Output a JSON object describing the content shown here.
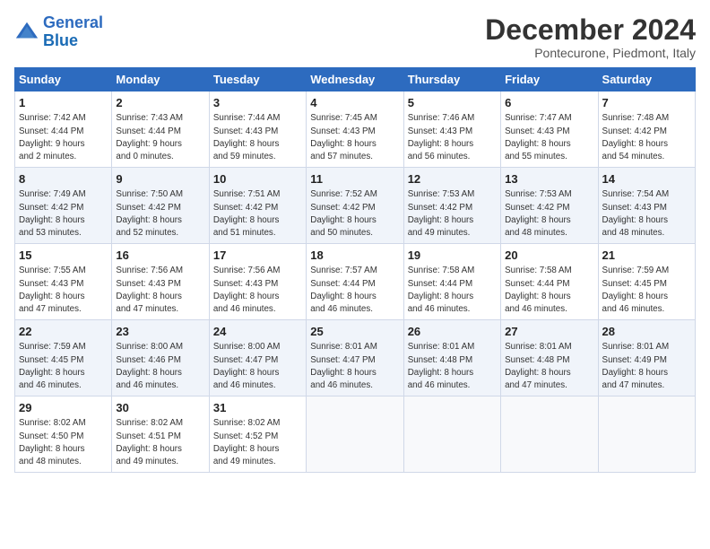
{
  "logo": {
    "line1": "General",
    "line2": "Blue"
  },
  "title": "December 2024",
  "subtitle": "Pontecurone, Piedmont, Italy",
  "days_header": [
    "Sunday",
    "Monday",
    "Tuesday",
    "Wednesday",
    "Thursday",
    "Friday",
    "Saturday"
  ],
  "weeks": [
    [
      {
        "num": "1",
        "info": "Sunrise: 7:42 AM\nSunset: 4:44 PM\nDaylight: 9 hours\nand 2 minutes."
      },
      {
        "num": "2",
        "info": "Sunrise: 7:43 AM\nSunset: 4:44 PM\nDaylight: 9 hours\nand 0 minutes."
      },
      {
        "num": "3",
        "info": "Sunrise: 7:44 AM\nSunset: 4:43 PM\nDaylight: 8 hours\nand 59 minutes."
      },
      {
        "num": "4",
        "info": "Sunrise: 7:45 AM\nSunset: 4:43 PM\nDaylight: 8 hours\nand 57 minutes."
      },
      {
        "num": "5",
        "info": "Sunrise: 7:46 AM\nSunset: 4:43 PM\nDaylight: 8 hours\nand 56 minutes."
      },
      {
        "num": "6",
        "info": "Sunrise: 7:47 AM\nSunset: 4:43 PM\nDaylight: 8 hours\nand 55 minutes."
      },
      {
        "num": "7",
        "info": "Sunrise: 7:48 AM\nSunset: 4:42 PM\nDaylight: 8 hours\nand 54 minutes."
      }
    ],
    [
      {
        "num": "8",
        "info": "Sunrise: 7:49 AM\nSunset: 4:42 PM\nDaylight: 8 hours\nand 53 minutes."
      },
      {
        "num": "9",
        "info": "Sunrise: 7:50 AM\nSunset: 4:42 PM\nDaylight: 8 hours\nand 52 minutes."
      },
      {
        "num": "10",
        "info": "Sunrise: 7:51 AM\nSunset: 4:42 PM\nDaylight: 8 hours\nand 51 minutes."
      },
      {
        "num": "11",
        "info": "Sunrise: 7:52 AM\nSunset: 4:42 PM\nDaylight: 8 hours\nand 50 minutes."
      },
      {
        "num": "12",
        "info": "Sunrise: 7:53 AM\nSunset: 4:42 PM\nDaylight: 8 hours\nand 49 minutes."
      },
      {
        "num": "13",
        "info": "Sunrise: 7:53 AM\nSunset: 4:42 PM\nDaylight: 8 hours\nand 48 minutes."
      },
      {
        "num": "14",
        "info": "Sunrise: 7:54 AM\nSunset: 4:43 PM\nDaylight: 8 hours\nand 48 minutes."
      }
    ],
    [
      {
        "num": "15",
        "info": "Sunrise: 7:55 AM\nSunset: 4:43 PM\nDaylight: 8 hours\nand 47 minutes."
      },
      {
        "num": "16",
        "info": "Sunrise: 7:56 AM\nSunset: 4:43 PM\nDaylight: 8 hours\nand 47 minutes."
      },
      {
        "num": "17",
        "info": "Sunrise: 7:56 AM\nSunset: 4:43 PM\nDaylight: 8 hours\nand 46 minutes."
      },
      {
        "num": "18",
        "info": "Sunrise: 7:57 AM\nSunset: 4:44 PM\nDaylight: 8 hours\nand 46 minutes."
      },
      {
        "num": "19",
        "info": "Sunrise: 7:58 AM\nSunset: 4:44 PM\nDaylight: 8 hours\nand 46 minutes."
      },
      {
        "num": "20",
        "info": "Sunrise: 7:58 AM\nSunset: 4:44 PM\nDaylight: 8 hours\nand 46 minutes."
      },
      {
        "num": "21",
        "info": "Sunrise: 7:59 AM\nSunset: 4:45 PM\nDaylight: 8 hours\nand 46 minutes."
      }
    ],
    [
      {
        "num": "22",
        "info": "Sunrise: 7:59 AM\nSunset: 4:45 PM\nDaylight: 8 hours\nand 46 minutes."
      },
      {
        "num": "23",
        "info": "Sunrise: 8:00 AM\nSunset: 4:46 PM\nDaylight: 8 hours\nand 46 minutes."
      },
      {
        "num": "24",
        "info": "Sunrise: 8:00 AM\nSunset: 4:47 PM\nDaylight: 8 hours\nand 46 minutes."
      },
      {
        "num": "25",
        "info": "Sunrise: 8:01 AM\nSunset: 4:47 PM\nDaylight: 8 hours\nand 46 minutes."
      },
      {
        "num": "26",
        "info": "Sunrise: 8:01 AM\nSunset: 4:48 PM\nDaylight: 8 hours\nand 46 minutes."
      },
      {
        "num": "27",
        "info": "Sunrise: 8:01 AM\nSunset: 4:48 PM\nDaylight: 8 hours\nand 47 minutes."
      },
      {
        "num": "28",
        "info": "Sunrise: 8:01 AM\nSunset: 4:49 PM\nDaylight: 8 hours\nand 47 minutes."
      }
    ],
    [
      {
        "num": "29",
        "info": "Sunrise: 8:02 AM\nSunset: 4:50 PM\nDaylight: 8 hours\nand 48 minutes."
      },
      {
        "num": "30",
        "info": "Sunrise: 8:02 AM\nSunset: 4:51 PM\nDaylight: 8 hours\nand 49 minutes."
      },
      {
        "num": "31",
        "info": "Sunrise: 8:02 AM\nSunset: 4:52 PM\nDaylight: 8 hours\nand 49 minutes."
      },
      null,
      null,
      null,
      null
    ]
  ]
}
